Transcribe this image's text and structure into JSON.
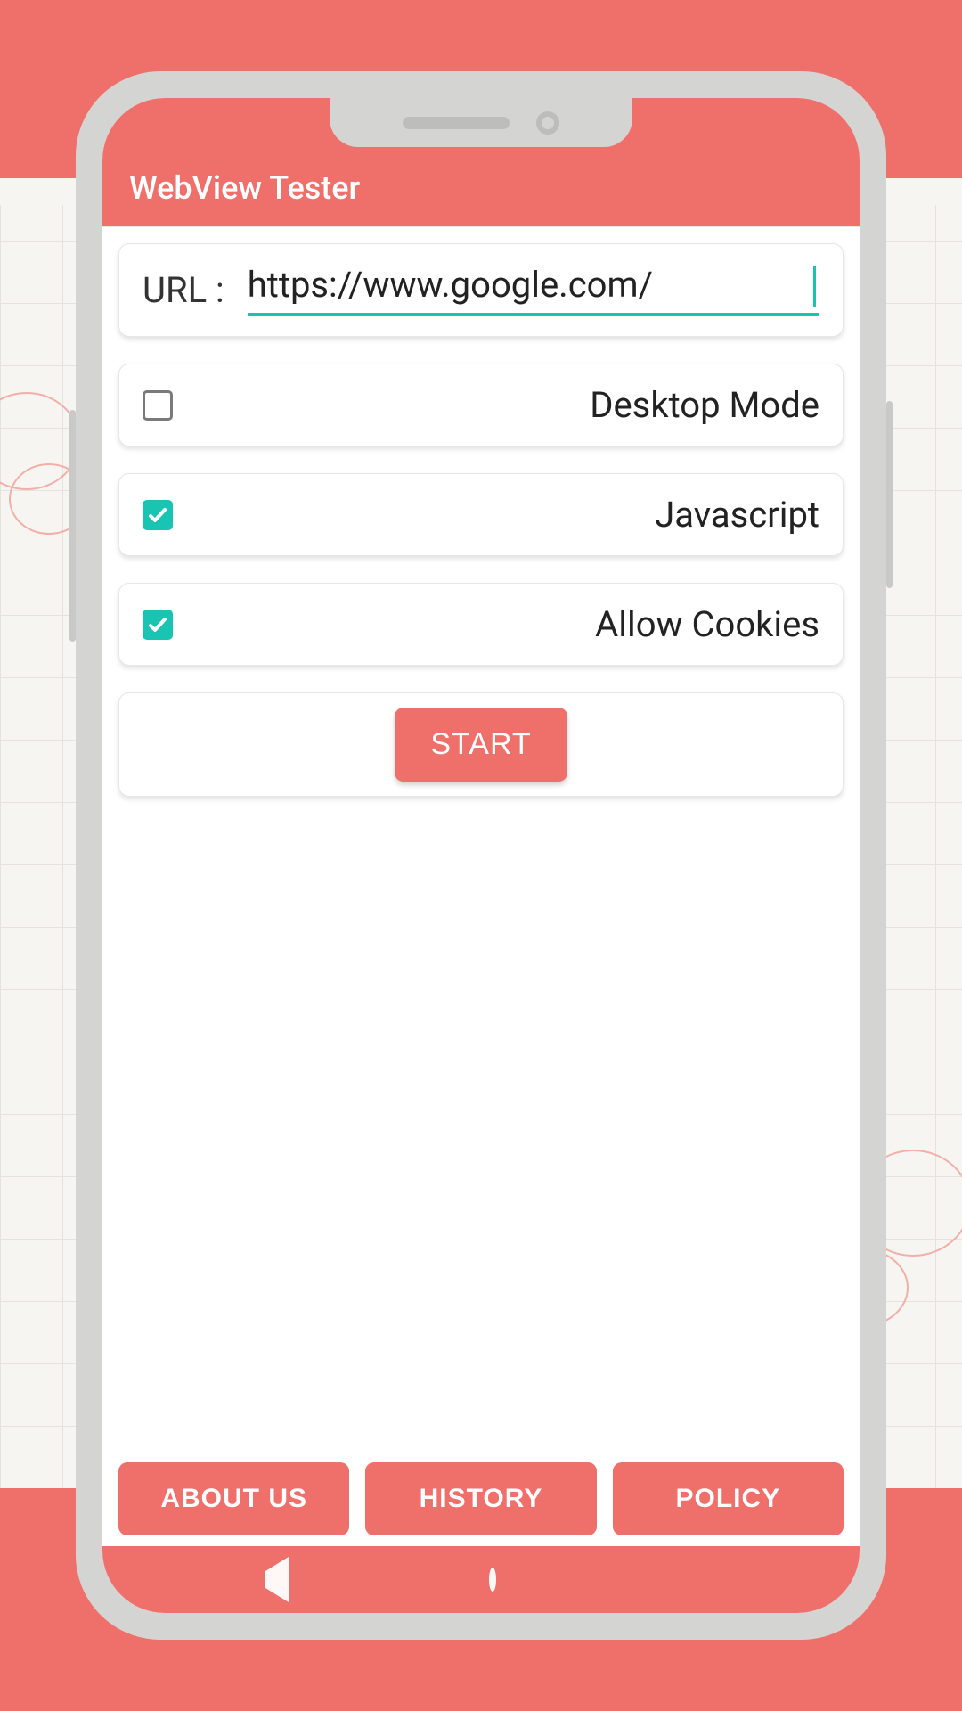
{
  "colors": {
    "accent": "#ef6f6a",
    "teal": "#19c5b2"
  },
  "app": {
    "title": "WebView Tester"
  },
  "url": {
    "label": "URL :",
    "value": "https://www.google.com/"
  },
  "options": [
    {
      "label": "Desktop Mode",
      "checked": false
    },
    {
      "label": "Javascript",
      "checked": true
    },
    {
      "label": "Allow Cookies",
      "checked": true
    }
  ],
  "start": {
    "label": "START"
  },
  "bottom": {
    "about": "ABOUT US",
    "history": "HISTORY",
    "policy": "POLICY"
  }
}
